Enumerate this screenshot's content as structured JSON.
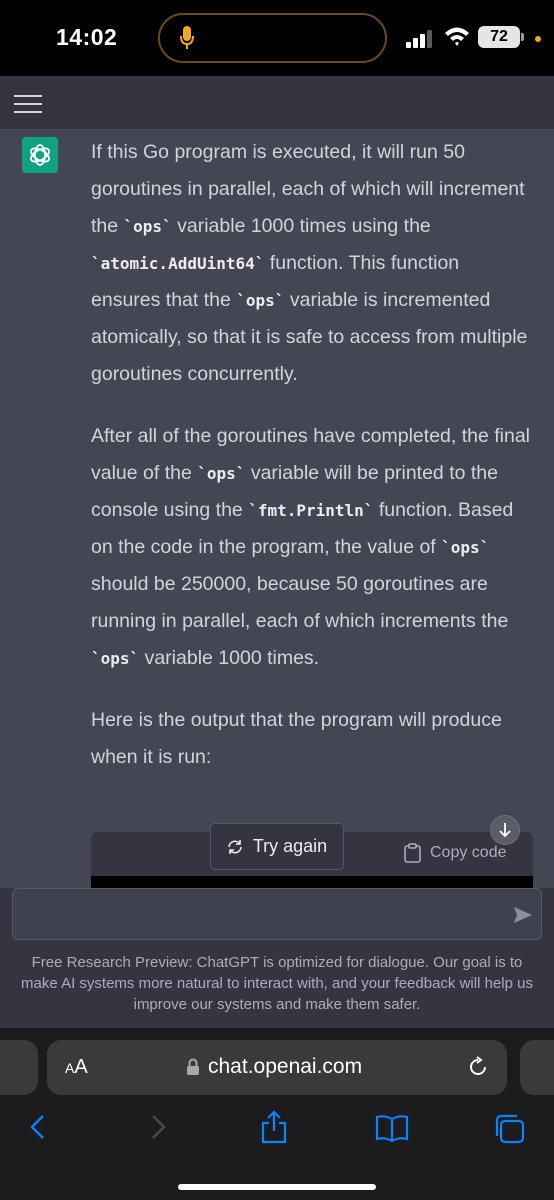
{
  "status_bar": {
    "time": "14:02",
    "battery": "72",
    "icons": [
      "microphone-icon",
      "signal-icon",
      "wifi-icon",
      "battery-icon"
    ]
  },
  "colors": {
    "chat_bg": "#444654",
    "header_bg": "#343541",
    "assistant_avatar": "#10a37f",
    "text": "#d1d5db"
  },
  "message": {
    "p1": {
      "t1": "If this Go program is executed, it will run 50 goroutines in parallel, each of which will increment the ",
      "c1": "`ops`",
      "t2": " variable 1000 times using the ",
      "c2": "`atomic.AddUint64`",
      "t3": " function. This function ensures that the ",
      "c3": "`ops`",
      "t4": " variable is incremented atomically, so that it is safe to access from multiple goroutines concurrently."
    },
    "p2": {
      "t1": "After all of the goroutines have completed, the final value of the ",
      "c1": "`ops`",
      "t2": " variable will be printed to the console using the ",
      "c2": "`fmt.Println`",
      "t3": " function. Based on the code in the program, the value of ",
      "c3": "`ops`",
      "t4": " should be 250000, because 50 goroutines are running in parallel, each of which increments the ",
      "c4": "`ops`",
      "t5": " variable 1000 times."
    },
    "p3": "Here is the output that the program will produce when it is run:"
  },
  "code_block": {
    "copy_label": "Copy code"
  },
  "try_again_label": "Try again",
  "composer": {
    "placeholder": ""
  },
  "disclaimer": "Free Research Preview: ChatGPT is optimized for dialogue. Our goal is to make AI systems more natural to interact with, and your feedback will help us improve our systems and make them safer.",
  "safari": {
    "aa_big": "A",
    "aa_small": "A",
    "url": "chat.openai.com"
  }
}
